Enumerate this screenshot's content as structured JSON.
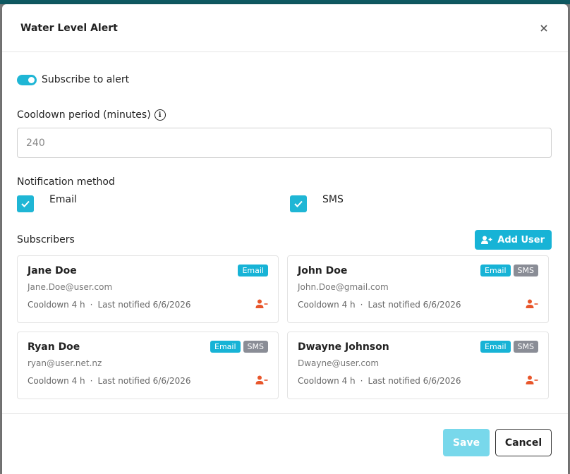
{
  "modal": {
    "title": "Water Level Alert"
  },
  "subscribe": {
    "label": "Subscribe to alert",
    "enabled": true
  },
  "cooldown": {
    "label": "Cooldown period (minutes)",
    "value": "240",
    "info_icon": "info-icon"
  },
  "notification": {
    "label": "Notification method",
    "methods": [
      {
        "label": "Email",
        "checked": true
      },
      {
        "label": "SMS",
        "checked": true
      }
    ]
  },
  "subscribers": {
    "label": "Subscribers",
    "add_label": "Add User",
    "list": [
      {
        "name": "Jane Doe",
        "email": "Jane.Doe@user.com",
        "cooldown": "Cooldown 4 h",
        "last": "Last notified 6/6/2026",
        "badges": [
          "Email"
        ]
      },
      {
        "name": "John Doe",
        "email": "John.Doe@gmail.com",
        "cooldown": "Cooldown 4 h",
        "last": "Last notified 6/6/2026",
        "badges": [
          "Email",
          "SMS"
        ]
      },
      {
        "name": "Ryan Doe",
        "email": "ryan@user.net.nz",
        "cooldown": "Cooldown 4 h",
        "last": "Last notified 6/6/2026",
        "badges": [
          "Email",
          "SMS"
        ]
      },
      {
        "name": "Dwayne Johnson",
        "email": "Dwayne@user.com",
        "cooldown": "Cooldown 4 h",
        "last": "Last notified 6/6/2026",
        "badges": [
          "Email",
          "SMS"
        ]
      }
    ]
  },
  "footer": {
    "save_label": "Save",
    "cancel_label": "Cancel"
  },
  "colors": {
    "accent": "#1fb6d5",
    "sms_badge": "#8a8d96",
    "remove": "#e8562b",
    "save_disabled": "#78d8eb"
  }
}
